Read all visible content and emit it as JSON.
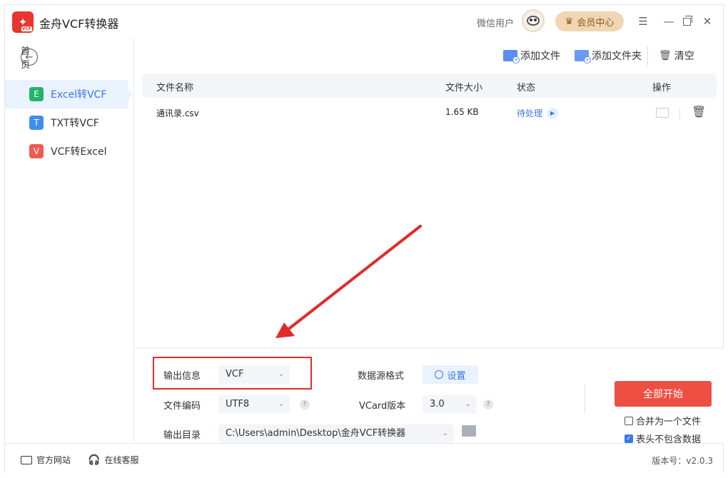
{
  "app": {
    "title": "金舟VCF转换器",
    "logo_text": "VCF"
  },
  "header": {
    "user_name": "微信用户",
    "member_label": "会员中心"
  },
  "sidebar": {
    "home_label": "首页",
    "items": [
      {
        "badge": "E",
        "label": "Excel转VCF",
        "active": true,
        "color": "#21b46a"
      },
      {
        "badge": "T",
        "label": "TXT转VCF",
        "active": false,
        "color": "#3f8df0"
      },
      {
        "badge": "V",
        "label": "VCF转Excel",
        "active": false,
        "color": "#ef5a4f"
      }
    ]
  },
  "toolbar": {
    "add_file_label": "添加文件",
    "add_folder_label": "添加文件夹",
    "clear_label": "清空"
  },
  "table": {
    "headers": {
      "name": "文件名称",
      "size": "文件大小",
      "status": "状态",
      "ops": "操作"
    },
    "rows": [
      {
        "name": "通讯录.csv",
        "size": "1.65 KB",
        "status": "待处理"
      }
    ]
  },
  "settings": {
    "output_info_label": "输出信息",
    "output_format": "VCF",
    "encoding_label": "文件编码",
    "encoding": "UTF8",
    "output_dir_label": "输出目录",
    "output_dir": "C:\\Users\\admin\\Desktop\\金舟VCF转换器",
    "source_format_label": "数据源格式",
    "set_button_label": "设置",
    "vcard_version_label": "VCard版本",
    "vcard_version": "3.0",
    "help_glyph": "?"
  },
  "actions": {
    "start_all_label": "全部开始",
    "merge_label": "合并为一个文件",
    "merge_checked": false,
    "header_excluded_label": "表头不包含数据",
    "header_excluded_checked": true
  },
  "footer": {
    "website_label": "官方网站",
    "support_label": "在线客服",
    "version_label": "版本号：v2.0.3"
  },
  "colors": {
    "accent": "#3a77e8",
    "start": "#ee4f43",
    "highlight": "#e02b2b"
  }
}
